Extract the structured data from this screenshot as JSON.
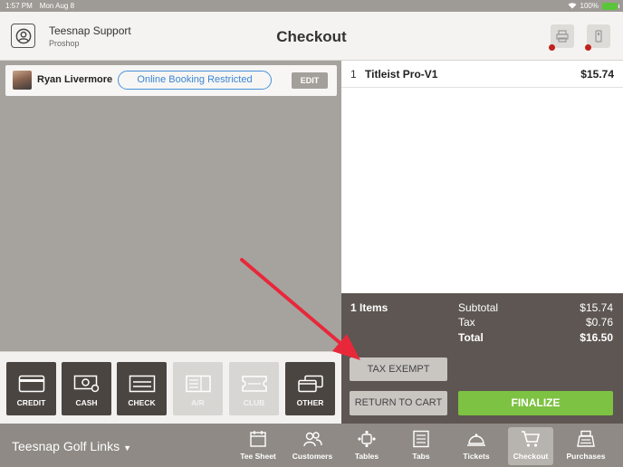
{
  "status_bar": {
    "time": "1:57 PM",
    "date": "Mon Aug 8",
    "battery": "100%"
  },
  "header": {
    "user_name": "Teesnap Support",
    "user_role": "Proshop",
    "title": "Checkout"
  },
  "customer": {
    "name": "Ryan Livermore",
    "badge": "Online Booking Restricted",
    "edit_label": "EDIT"
  },
  "payment_methods": [
    {
      "label": "CREDIT",
      "icon": "credit-card-icon",
      "enabled": true
    },
    {
      "label": "CASH",
      "icon": "cash-icon",
      "enabled": true
    },
    {
      "label": "CHECK",
      "icon": "check-icon",
      "enabled": true
    },
    {
      "label": "A/R",
      "icon": "ar-ledger-icon",
      "enabled": false
    },
    {
      "label": "CLUB",
      "icon": "club-ticket-icon",
      "enabled": false
    },
    {
      "label": "OTHER",
      "icon": "other-cards-icon",
      "enabled": true
    }
  ],
  "cart": {
    "items": [
      {
        "qty": "1",
        "name": "Titleist Pro-V1",
        "price": "$15.74"
      }
    ]
  },
  "summary": {
    "items_count": "1 Items",
    "subtotal_label": "Subtotal",
    "subtotal_value": "$15.74",
    "tax_label": "Tax",
    "tax_value": "$0.76",
    "total_label": "Total",
    "total_value": "$16.50",
    "tax_exempt_label": "TAX EXEMPT",
    "return_label": "RETURN TO CART",
    "finalize_label": "FINALIZE"
  },
  "bottom_nav": {
    "location": "Teesnap Golf Links",
    "items": [
      {
        "label": "Tee Sheet",
        "icon": "calendar-icon"
      },
      {
        "label": "Customers",
        "icon": "customers-icon"
      },
      {
        "label": "Tables",
        "icon": "tables-icon"
      },
      {
        "label": "Tabs",
        "icon": "tabs-icon"
      },
      {
        "label": "Tickets",
        "icon": "tickets-icon"
      },
      {
        "label": "Checkout",
        "icon": "cart-icon",
        "active": true
      },
      {
        "label": "Purchases",
        "icon": "register-icon"
      }
    ]
  },
  "colors": {
    "accent_green": "#7dc242",
    "badge_blue": "#3b86d4",
    "dark_panel": "#5d5652",
    "annotation_red": "#e8283a"
  }
}
